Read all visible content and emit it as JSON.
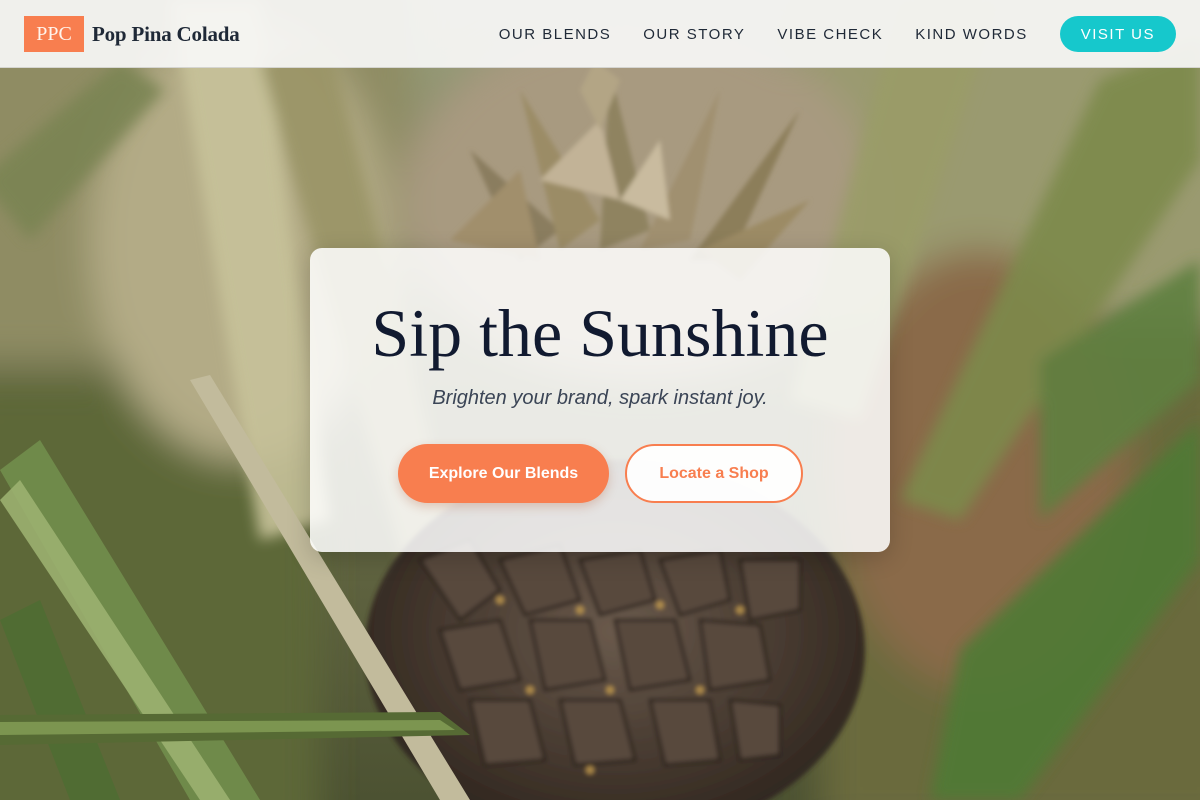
{
  "theme": {
    "accent": "#f87e4f",
    "teal": "#16c8cc",
    "ink": "#111a30"
  },
  "header": {
    "logo_badge": "PPC",
    "brand_name": "Pop Pina Colada",
    "nav": [
      {
        "label": "OUR BLENDS"
      },
      {
        "label": "OUR STORY"
      },
      {
        "label": "VIBE CHECK"
      },
      {
        "label": "KIND WORDS"
      }
    ],
    "cta_label": "VISIT US"
  },
  "hero": {
    "title": "Sip the Sunshine",
    "subtitle": "Brighten your brand, spark instant joy.",
    "primary_button": "Explore Our Blends",
    "secondary_button": "Locate a Shop"
  }
}
